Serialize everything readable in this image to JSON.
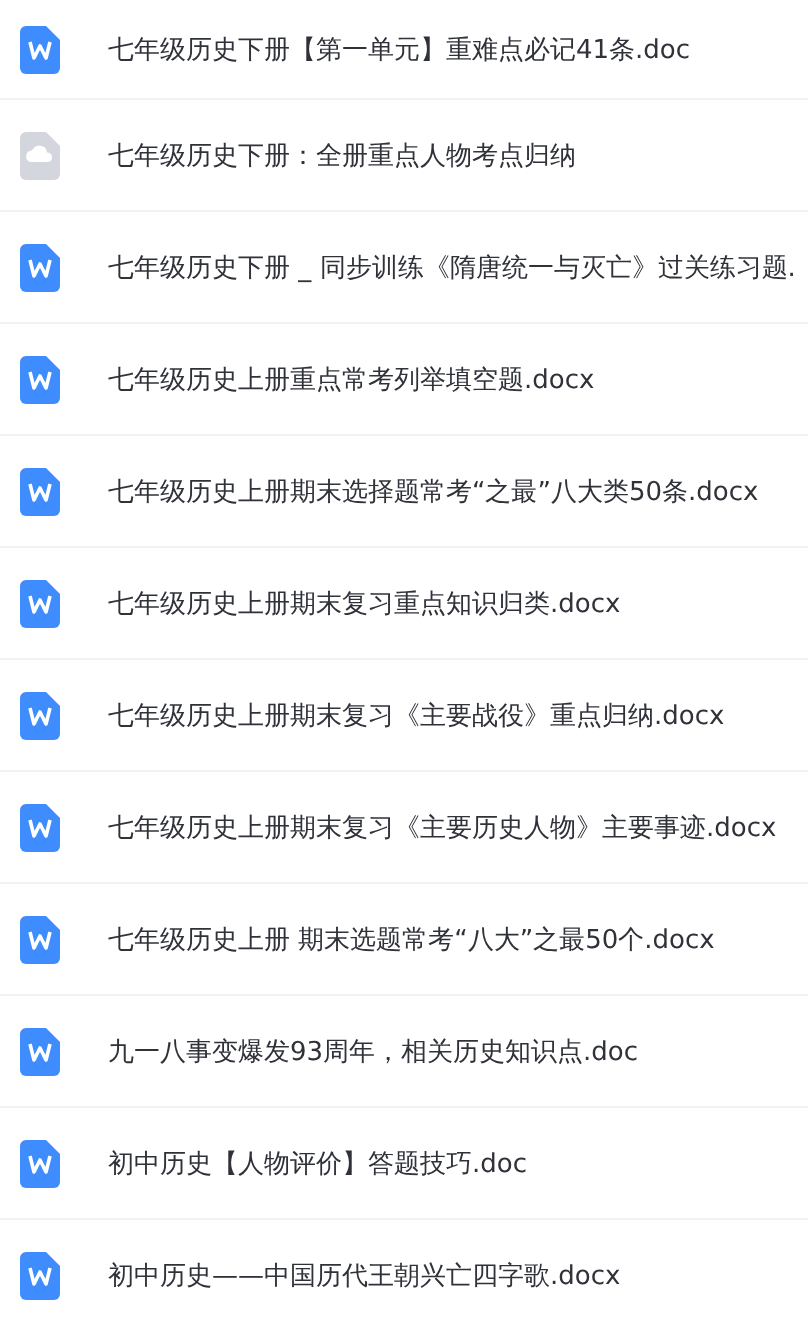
{
  "files": [
    {
      "kind": "word",
      "name": "七年级历史下册【第一单元】重难点必记41条.doc"
    },
    {
      "kind": "cloud",
      "name": "七年级历史下册：全册重点人物考点归纳"
    },
    {
      "kind": "word",
      "name": "七年级历史下册 _ 同步训练《隋唐统一与灭亡》过关练习题."
    },
    {
      "kind": "word",
      "name": "七年级历史上册重点常考列举填空题.docx"
    },
    {
      "kind": "word",
      "name": "七年级历史上册期末选择题常考“之最”八大类50条.docx"
    },
    {
      "kind": "word",
      "name": "七年级历史上册期末复习重点知识归类.docx"
    },
    {
      "kind": "word",
      "name": "七年级历史上册期末复习《主要战役》重点归纳.docx"
    },
    {
      "kind": "word",
      "name": "七年级历史上册期末复习《主要历史人物》主要事迹.docx"
    },
    {
      "kind": "word",
      "name": "七年级历史上册 期末选题常考“八大”之最50个.docx"
    },
    {
      "kind": "word",
      "name": "九一八事变爆发93周年，相关历史知识点.doc"
    },
    {
      "kind": "word",
      "name": "初中历史【人物评价】答题技巧.doc"
    },
    {
      "kind": "word",
      "name": "初中历史——中国历代王朝兴亡四字歌.docx"
    }
  ]
}
